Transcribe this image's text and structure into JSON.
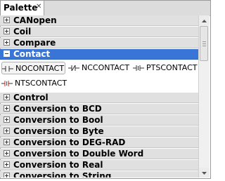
{
  "tab": {
    "title": "Palette",
    "close_icon": "close-x-icon"
  },
  "categories_before": [
    {
      "label": "CANopen"
    },
    {
      "label": "Coil"
    },
    {
      "label": "Compare"
    }
  ],
  "selected_category": {
    "label": "Contact"
  },
  "tools": [
    {
      "label": "NOCONTACT",
      "icon": "no-contact-icon",
      "active": true
    },
    {
      "label": "NCCONTACT",
      "icon": "nc-contact-icon"
    },
    {
      "label": "PTSCONTACT",
      "icon": "pts-contact-icon"
    },
    {
      "label": "NTSCONTACT",
      "icon": "nts-contact-icon"
    }
  ],
  "categories_after": [
    {
      "label": "Control"
    },
    {
      "label": "Conversion to BCD"
    },
    {
      "label": "Conversion to Bool"
    },
    {
      "label": "Conversion to Byte"
    },
    {
      "label": "Conversion to DEG-RAD"
    },
    {
      "label": "Conversion to Double Word"
    },
    {
      "label": "Conversion to Real"
    },
    {
      "label": "Conversion to String"
    }
  ],
  "colors": {
    "selection": "#3875d7",
    "category_bg": "#e0e0e0",
    "contact_red": "#cc2222"
  }
}
